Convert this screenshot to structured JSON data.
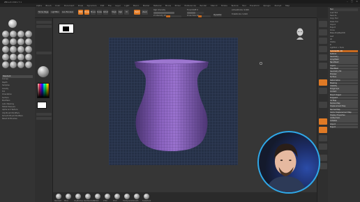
{
  "window": {
    "title": "ZBrush 2021.7.1"
  },
  "menu": [
    "Alpha",
    "Brush",
    "Color",
    "Document",
    "Draw",
    "Dynamics",
    "Edit",
    "File",
    "Layer",
    "Light",
    "Macro",
    "Marker",
    "Material",
    "Movie",
    "Picker",
    "Preferences",
    "Render",
    "Stencil",
    "Stroke",
    "Texture",
    "Tool",
    "Transform",
    "Zplugin",
    "Zscript",
    "Help"
  ],
  "top_shelf": {
    "home_page": "Home Page",
    "lightbox": "LightBox",
    "live_boolean": "Live Boolean",
    "edit": "Edit",
    "draw": "Draw",
    "move": "Move",
    "scale": "Scale",
    "rotate": "Rotate",
    "mrgb": "Mrgb",
    "rgb": "Rgb",
    "m": "M",
    "zadd": "Zadd",
    "zsub": "Zsub",
    "rgb_intensity": "Rgb Intensity",
    "z_intensity": "Z Intensity 25",
    "focal_shift": "Focal Shift 0",
    "draw_size": "Draw Size 64",
    "dynamic": "Dynamic",
    "active_points": "ActivePoints: 9,600",
    "total_points": "TotalPoints: 9,600"
  },
  "left_palette": {
    "items": [
      "Standard",
      "Curves",
      "Depth",
      "Samples",
      "Gravity",
      "Tilt",
      "Orientation",
      "Surface",
      "Modifiers",
      "Auto Masking",
      "Tablet Pressure",
      "Alpha and Texture",
      "Clip Brush Modifiers",
      "Smooth Brush Modifiers",
      "Reset All Brushes"
    ],
    "highlight_index": 0
  },
  "canvas": {
    "vase_colors": {
      "body": "#7a55a8",
      "rim": "#8c66bd",
      "shade": "#3e2a5c"
    }
  },
  "bottom_shelf": [
    "Standard",
    "Move",
    "ClayBuildup",
    "DamStandard",
    "hPolish",
    "Inflat",
    "Pinch",
    "TrimDynamic",
    "Smooth",
    "SnakeHook"
  ],
  "right_panel": {
    "title": "Tool",
    "items": [
      "Load Tool",
      "Save As",
      "Copy Tool",
      "Paste Tool",
      "Import",
      "Export",
      "Clone",
      "Make PolyMesh3D",
      "GoZ",
      "All",
      "Visible",
      "R",
      "Lightbox > Tools",
      "Cylinder3D. 48",
      "Subtool",
      "Geometry",
      "ArrayMesh",
      "NanoMesh",
      "Layers",
      "FiberMesh",
      "Geometry HD",
      "Preview",
      "Surface",
      "Deformation",
      "Masking",
      "Visibility",
      "Polygroups",
      "Contact",
      "Morph Target",
      "Polypaint",
      "UV Map",
      "Texture Map",
      "Displacement Map",
      "Normal Map",
      "Vector Displacement Map",
      "Display Properties",
      "Unified Skin",
      "Initialize",
      "Import",
      "Export"
    ]
  },
  "colors": {
    "accent": "#e07a25",
    "cam_ring": "#2fa8e8"
  }
}
